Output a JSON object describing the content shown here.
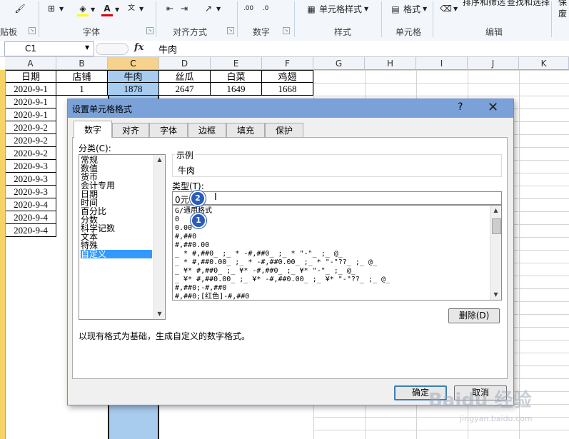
{
  "ribbon": {
    "groups": [
      {
        "label": "贴板"
      },
      {
        "label": "字体"
      },
      {
        "label": "对齐方式"
      },
      {
        "label": "数字"
      },
      {
        "label": "样式"
      },
      {
        "label": "单元格"
      },
      {
        "label": "编辑"
      }
    ],
    "cell_style_label": "单元格样式",
    "format_label": "格式",
    "sort_filter_label": "排序和筛选",
    "find_select_label": "查找和选择",
    "right_fragment_1": "保",
    "right_fragment_2": "废"
  },
  "formula_bar": {
    "name_box": "C1",
    "fx_label": "fx",
    "value": "牛肉"
  },
  "sheet": {
    "columns": [
      "A",
      "B",
      "C",
      "D",
      "E",
      "F",
      "G",
      "H",
      "I",
      "J",
      "K"
    ],
    "selected_column": "C",
    "header_row": [
      "日期",
      "店铺",
      "牛肉",
      "丝瓜",
      "白菜",
      "鸡翅"
    ],
    "row1": [
      "2020-9-1",
      "1",
      "1878",
      "2647",
      "1649",
      "1668"
    ],
    "dates": [
      "2020-9-1",
      "2020-9-1",
      "2020-9-2",
      "2020-9-2",
      "2020-9-2",
      "2020-9-3",
      "2020-9-3",
      "2020-9-3",
      "2020-9-4",
      "2020-9-4",
      "2020-9-4"
    ]
  },
  "dialog": {
    "title": "设置单元格格式",
    "help": "?",
    "close": "✕",
    "tabs": [
      "数字",
      "对齐",
      "字体",
      "边框",
      "填充",
      "保护"
    ],
    "active_tab": "数字",
    "category_label": "分类(C):",
    "categories": [
      "常规",
      "数值",
      "货币",
      "会计专用",
      "日期",
      "时间",
      "百分比",
      "分数",
      "科学记数",
      "文本",
      "特殊",
      "自定义"
    ],
    "selected_category": "自定义",
    "sample_label": "示例",
    "sample_value": "牛肉",
    "type_label": "类型(T):",
    "type_value": "0元",
    "formats": [
      "G/通用格式",
      "0",
      "0.00",
      "#,##0",
      "#,##0.00",
      "_ * #,##0_ ;_ * -#,##0_ ;_ * \"-\"_ ;_ @_",
      "_ * #,##0.00_ ;_ * -#,##0.00_ ;_ * \"-\"??_ ;_ @_",
      "_ ¥* #,##0_ ;_ ¥* -#,##0_ ;_ ¥* \"-\"_ ;_ @_",
      "_ ¥* #,##0.00_ ;_ ¥* -#,##0.00_ ;_ ¥* \"-\"??_ ;_ @_",
      "#,##0;-#,##0",
      "#,##0;[红色]-#,##0"
    ],
    "delete_button": "删除(D)",
    "description": "以现有格式为基础，生成自定义的数字格式。",
    "ok_button": "确定",
    "cancel_button": "取消",
    "badge_1": "1",
    "badge_2": "2"
  },
  "watermark": {
    "main": "Baidu 经验",
    "sub": "jingyan.baidu.com"
  }
}
